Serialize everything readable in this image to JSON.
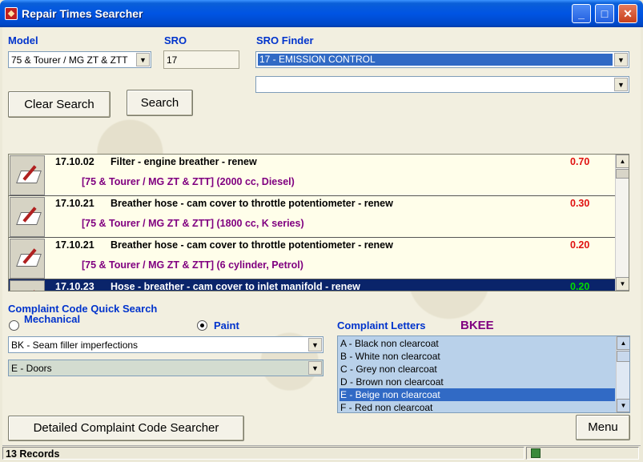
{
  "window": {
    "title": "Repair Times Searcher"
  },
  "model": {
    "label": "Model",
    "value": "75 & Tourer / MG ZT & ZTT"
  },
  "sro": {
    "label": "SRO",
    "value": "17"
  },
  "sro_finder": {
    "label": "SRO Finder",
    "value": "17 - EMISSION CONTROL",
    "second_value": ""
  },
  "buttons": {
    "clear_search": "Clear Search",
    "search": "Search",
    "detailed": "Detailed Complaint Code Searcher",
    "menu": "Menu"
  },
  "results": [
    {
      "code": "17.10.02",
      "description": "Filter - engine breather - renew",
      "model": "[75 & Tourer / MG ZT & ZTT] (2000 cc, Diesel)",
      "time": "0.70"
    },
    {
      "code": "17.10.21",
      "description": "Breather hose - cam cover to throttle potentiometer - renew",
      "model": "[75 & Tourer / MG ZT & ZTT] (1800 cc, K series)",
      "time": "0.30"
    },
    {
      "code": "17.10.21",
      "description": "Breather hose - cam cover to throttle potentiometer - renew",
      "model": "[75 & Tourer / MG ZT & ZTT] (6 cylinder, Petrol)",
      "time": "0.20"
    },
    {
      "code": "17.10.23",
      "description": "Hose - breather - cam cover to inlet manifold - renew",
      "model": "",
      "time": "0.20"
    }
  ],
  "complaint": {
    "label": "Complaint Code Quick Search",
    "radio_mechanical": "Mechanical",
    "radio_paint": "Paint",
    "selected_mode": "Paint",
    "code_value": "BK - Seam filler imperfections",
    "area_value": "E - Doors"
  },
  "letters": {
    "label": "Complaint Letters",
    "current": "BKEE",
    "items": [
      "A - Black non clearcoat",
      "B - White non clearcoat",
      "C - Grey non clearcoat",
      "D - Brown non clearcoat",
      "E - Beige non clearcoat",
      "F - Red non clearcoat"
    ],
    "selected_index": 4
  },
  "status": {
    "records": "13 Records"
  },
  "colors": {
    "accent": "#0033cc",
    "selection": "#0a246a",
    "time_red": "#e01010",
    "model_purple": "#800080"
  }
}
